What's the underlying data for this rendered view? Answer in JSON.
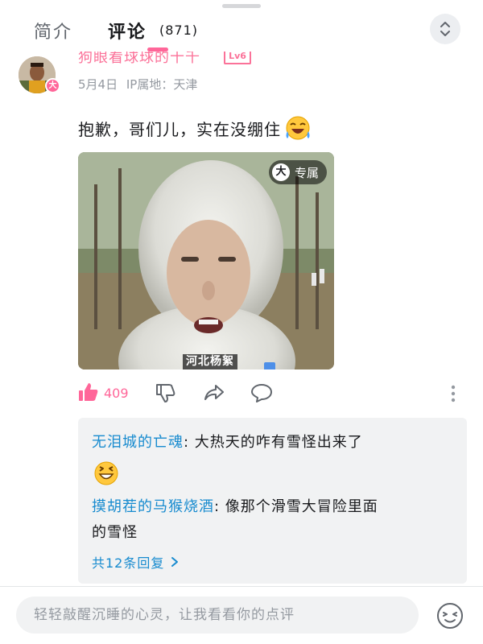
{
  "tabs": {
    "intro": "简介",
    "comments": "评论",
    "comment_count": "(871)"
  },
  "comment": {
    "username": "狗眼看球球的十千",
    "level": "Lv6",
    "avatar_badge": "大",
    "date": "5月4日",
    "ip_label": "IP属地：天津",
    "text": "抱歉，哥们儿，实在没绷住",
    "image": {
      "tag_icon": "大",
      "tag_label": "专属",
      "caption": "河北杨絮"
    },
    "like_count": "409"
  },
  "replies": {
    "items": [
      {
        "user": "无泪城的亡魂",
        "text": "大热天的咋有雪怪出来了"
      },
      {
        "user": "摸胡茬的马猴烧酒",
        "text_line1": "像那个滑雪大冒险里面",
        "text_line2": "的雪怪"
      }
    ],
    "more_label": "共12条回复"
  },
  "input": {
    "placeholder": "轻轻敲醒沉睡的心灵，让我看看你的点评"
  },
  "colors": {
    "accent_pink": "#ff6699",
    "link_blue": "#178bcf",
    "reply_bg": "#f1f2f3"
  },
  "icons": [
    "sort-toggle-icon",
    "thumbs-up-icon",
    "thumbs-down-icon",
    "share-icon",
    "reply-bubble-icon",
    "more-vertical-icon",
    "laughing-emoji-icon",
    "grinning-emoji-icon",
    "emoji-face-icon"
  ]
}
